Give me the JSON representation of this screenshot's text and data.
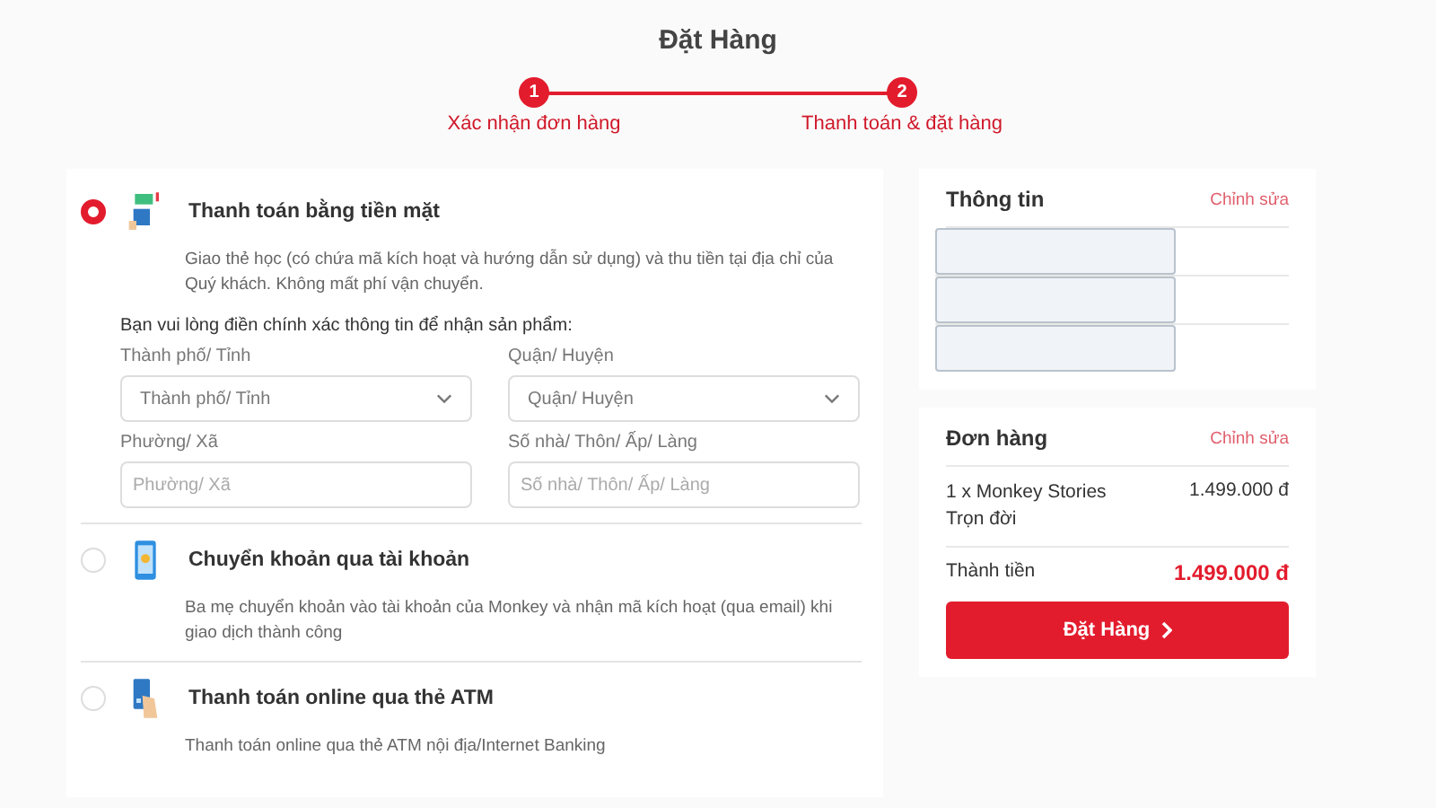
{
  "title": "Đặt Hàng",
  "steps": [
    {
      "number": "1",
      "label": "Xác nhận đơn hàng"
    },
    {
      "number": "2",
      "label": "Thanh toán & đặt hàng"
    }
  ],
  "payment_methods": [
    {
      "kind": "cash",
      "title": "Thanh toán bằng tiền mặt",
      "selected": true,
      "description": "Giao thẻ học (có chứa mã kích hoạt và hướng dẫn sử dụng) và thu tiền tại địa chỉ của Quý khách. Không mất phí vận chuyển.",
      "form": {
        "intro": "Bạn vui lòng điền chính xác thông tin để nhận sản phẩm:",
        "fields": [
          {
            "kind": "select",
            "label": "Thành phố/ Tỉnh",
            "placeholder": "Thành phố/ Tỉnh"
          },
          {
            "kind": "select",
            "label": "Quận/ Huyện",
            "placeholder": "Quận/ Huyện"
          },
          {
            "kind": "text",
            "label": "Phường/ Xã",
            "placeholder": "Phường/ Xã"
          },
          {
            "kind": "text",
            "label": "Số nhà/ Thôn/ Ấp/ Làng",
            "placeholder": "Số nhà/ Thôn/ Ấp/ Làng"
          }
        ]
      }
    },
    {
      "kind": "phone",
      "title": "Chuyển khoản qua tài khoản",
      "selected": false,
      "description": "Ba mẹ chuyển khoản vào tài khoản của Monkey và nhận mã kích hoạt (qua email) khi giao dịch thành công"
    },
    {
      "kind": "card",
      "title": "Thanh toán online qua thẻ ATM",
      "selected": false,
      "description": "Thanh toán online qua thẻ ATM nội địa/Internet Banking"
    }
  ],
  "info": {
    "title": "Thông tin",
    "edit": "Chỉnh sửa",
    "fields": [
      {
        "kind": "input"
      },
      {
        "kind": "input"
      },
      {
        "kind": "input"
      }
    ]
  },
  "order": {
    "title": "Đơn hàng",
    "edit": "Chỉnh sửa",
    "item": "1 x Monkey Stories Trọn đời",
    "item_price": "1.499.000 đ",
    "total_label": "Thành tiền",
    "total": "1.499.000 đ",
    "button": "Đặt Hàng"
  }
}
